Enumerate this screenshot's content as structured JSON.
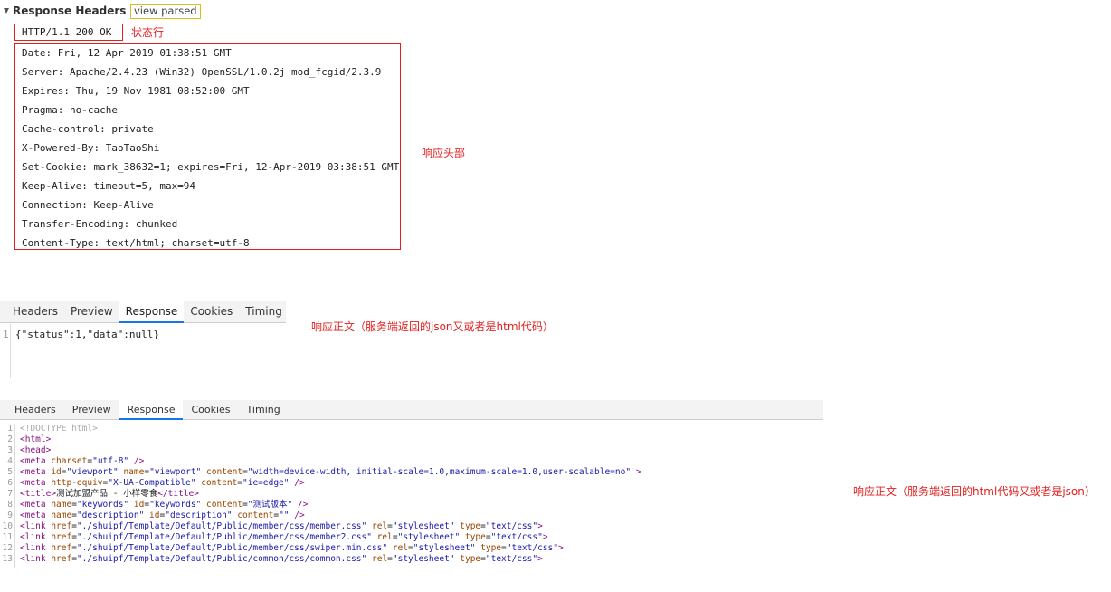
{
  "response_headers": {
    "title": "Response Headers",
    "view_parsed": "view parsed",
    "status_line": "HTTP/1.1 200 OK",
    "status_label": "状态行",
    "headers": [
      "Date: Fri, 12 Apr 2019 01:38:51 GMT",
      "Server: Apache/2.4.23 (Win32) OpenSSL/1.0.2j mod_fcgid/2.3.9",
      "Expires: Thu, 19 Nov 1981 08:52:00 GMT",
      "Pragma: no-cache",
      "Cache-control: private",
      "X-Powered-By: TaoTaoShi",
      "Set-Cookie: mark_38632=1; expires=Fri, 12-Apr-2019 03:38:51 GMT",
      "Keep-Alive: timeout=5, max=94",
      "Connection: Keep-Alive",
      "Transfer-Encoding: chunked",
      "Content-Type: text/html; charset=utf-8"
    ],
    "headers_label": "响应头部"
  },
  "panel1": {
    "tabs": [
      "Headers",
      "Preview",
      "Response",
      "Cookies",
      "Timing"
    ],
    "active_tab": "Response",
    "line_number": "1",
    "code": "{\"status\":1,\"data\":null}",
    "label": "响应正文（服务端返回的json又或者是html代码）"
  },
  "panel2": {
    "tabs": [
      "Headers",
      "Preview",
      "Response",
      "Cookies",
      "Timing"
    ],
    "active_tab": "Response",
    "label": "响应正文（服务端返回的html代码又或者是json）",
    "lines": [
      {
        "n": "1",
        "tokens": [
          [
            "doc",
            "<!DOCTYPE html>"
          ]
        ]
      },
      {
        "n": "2",
        "tokens": [
          [
            "tag",
            "<html>"
          ]
        ]
      },
      {
        "n": "3",
        "tokens": [
          [
            "tag",
            "<head>"
          ]
        ]
      },
      {
        "n": "4",
        "tokens": [
          [
            "tag",
            "<meta "
          ],
          [
            "attr",
            "charset"
          ],
          [
            "txt",
            "="
          ],
          [
            "val",
            "\"utf-8\""
          ],
          [
            "tag",
            " />"
          ]
        ]
      },
      {
        "n": "5",
        "tokens": [
          [
            "tag",
            "<meta "
          ],
          [
            "attr",
            "id"
          ],
          [
            "txt",
            "="
          ],
          [
            "val",
            "\"viewport\""
          ],
          [
            "tag",
            " "
          ],
          [
            "attr",
            "name"
          ],
          [
            "txt",
            "="
          ],
          [
            "val",
            "\"viewport\""
          ],
          [
            "tag",
            " "
          ],
          [
            "attr",
            "content"
          ],
          [
            "txt",
            "="
          ],
          [
            "val",
            "\"width=device-width, initial-scale=1.0,maximum-scale=1.0,user-scalable=no\""
          ],
          [
            "tag",
            " >"
          ]
        ]
      },
      {
        "n": "6",
        "tokens": [
          [
            "tag",
            "<meta "
          ],
          [
            "attr",
            "http-equiv"
          ],
          [
            "txt",
            "="
          ],
          [
            "val",
            "\"X-UA-Compatible\""
          ],
          [
            "tag",
            " "
          ],
          [
            "attr",
            "content"
          ],
          [
            "txt",
            "="
          ],
          [
            "val",
            "\"ie=edge\""
          ],
          [
            "tag",
            " />"
          ]
        ]
      },
      {
        "n": "7",
        "tokens": [
          [
            "tag",
            "<title>"
          ],
          [
            "txt",
            "测试加盟产品 - 小样零食"
          ],
          [
            "tag",
            "</title>"
          ]
        ]
      },
      {
        "n": "8",
        "tokens": [
          [
            "tag",
            "<meta "
          ],
          [
            "attr",
            "name"
          ],
          [
            "txt",
            "="
          ],
          [
            "val",
            "\"keywords\""
          ],
          [
            "tag",
            " "
          ],
          [
            "attr",
            "id"
          ],
          [
            "txt",
            "="
          ],
          [
            "val",
            "\"keywords\""
          ],
          [
            "tag",
            " "
          ],
          [
            "attr",
            "content"
          ],
          [
            "txt",
            "="
          ],
          [
            "val",
            "\"测试版本\""
          ],
          [
            "tag",
            " />"
          ]
        ]
      },
      {
        "n": "9",
        "tokens": [
          [
            "tag",
            "<meta "
          ],
          [
            "attr",
            "name"
          ],
          [
            "txt",
            "="
          ],
          [
            "val",
            "\"description\""
          ],
          [
            "tag",
            " "
          ],
          [
            "attr",
            "id"
          ],
          [
            "txt",
            "="
          ],
          [
            "val",
            "\"description\""
          ],
          [
            "tag",
            " "
          ],
          [
            "attr",
            "content"
          ],
          [
            "txt",
            "="
          ],
          [
            "val",
            "\"\""
          ],
          [
            "tag",
            " />"
          ]
        ]
      },
      {
        "n": "10",
        "tokens": [
          [
            "tag",
            "<link "
          ],
          [
            "attr",
            "href"
          ],
          [
            "txt",
            "="
          ],
          [
            "val",
            "\"./shuipf/Template/Default/Public/member/css/member.css\""
          ],
          [
            "tag",
            " "
          ],
          [
            "attr",
            "rel"
          ],
          [
            "txt",
            "="
          ],
          [
            "val",
            "\"stylesheet\""
          ],
          [
            "tag",
            " "
          ],
          [
            "attr",
            "type"
          ],
          [
            "txt",
            "="
          ],
          [
            "val",
            "\"text/css\""
          ],
          [
            "tag",
            ">"
          ]
        ]
      },
      {
        "n": "11",
        "tokens": [
          [
            "tag",
            "<link "
          ],
          [
            "attr",
            "href"
          ],
          [
            "txt",
            "="
          ],
          [
            "val",
            "\"./shuipf/Template/Default/Public/member/css/member2.css\""
          ],
          [
            "tag",
            " "
          ],
          [
            "attr",
            "rel"
          ],
          [
            "txt",
            "="
          ],
          [
            "val",
            "\"stylesheet\""
          ],
          [
            "tag",
            " "
          ],
          [
            "attr",
            "type"
          ],
          [
            "txt",
            "="
          ],
          [
            "val",
            "\"text/css\""
          ],
          [
            "tag",
            ">"
          ]
        ]
      },
      {
        "n": "12",
        "tokens": [
          [
            "tag",
            "<link "
          ],
          [
            "attr",
            "href"
          ],
          [
            "txt",
            "="
          ],
          [
            "val",
            "\"./shuipf/Template/Default/Public/member/css/swiper.min.css\""
          ],
          [
            "tag",
            " "
          ],
          [
            "attr",
            "rel"
          ],
          [
            "txt",
            "="
          ],
          [
            "val",
            "\"stylesheet\""
          ],
          [
            "tag",
            " "
          ],
          [
            "attr",
            "type"
          ],
          [
            "txt",
            "="
          ],
          [
            "val",
            "\"text/css\""
          ],
          [
            "tag",
            ">"
          ]
        ]
      },
      {
        "n": "13",
        "tokens": [
          [
            "tag",
            "<link "
          ],
          [
            "attr",
            "href"
          ],
          [
            "txt",
            "="
          ],
          [
            "val",
            "\"./shuipf/Template/Default/Public/common/css/common.css\""
          ],
          [
            "tag",
            " "
          ],
          [
            "attr",
            "rel"
          ],
          [
            "txt",
            "="
          ],
          [
            "val",
            "\"stylesheet\""
          ],
          [
            "tag",
            " "
          ],
          [
            "attr",
            "type"
          ],
          [
            "txt",
            "="
          ],
          [
            "val",
            "\"text/css\""
          ],
          [
            "tag",
            ">"
          ]
        ]
      }
    ]
  },
  "colors": {
    "annotation_red": "#e02020",
    "active_tab_accent": "#1a73e8",
    "tag": "#881280",
    "attr": "#994500",
    "value": "#1a1aa6"
  }
}
